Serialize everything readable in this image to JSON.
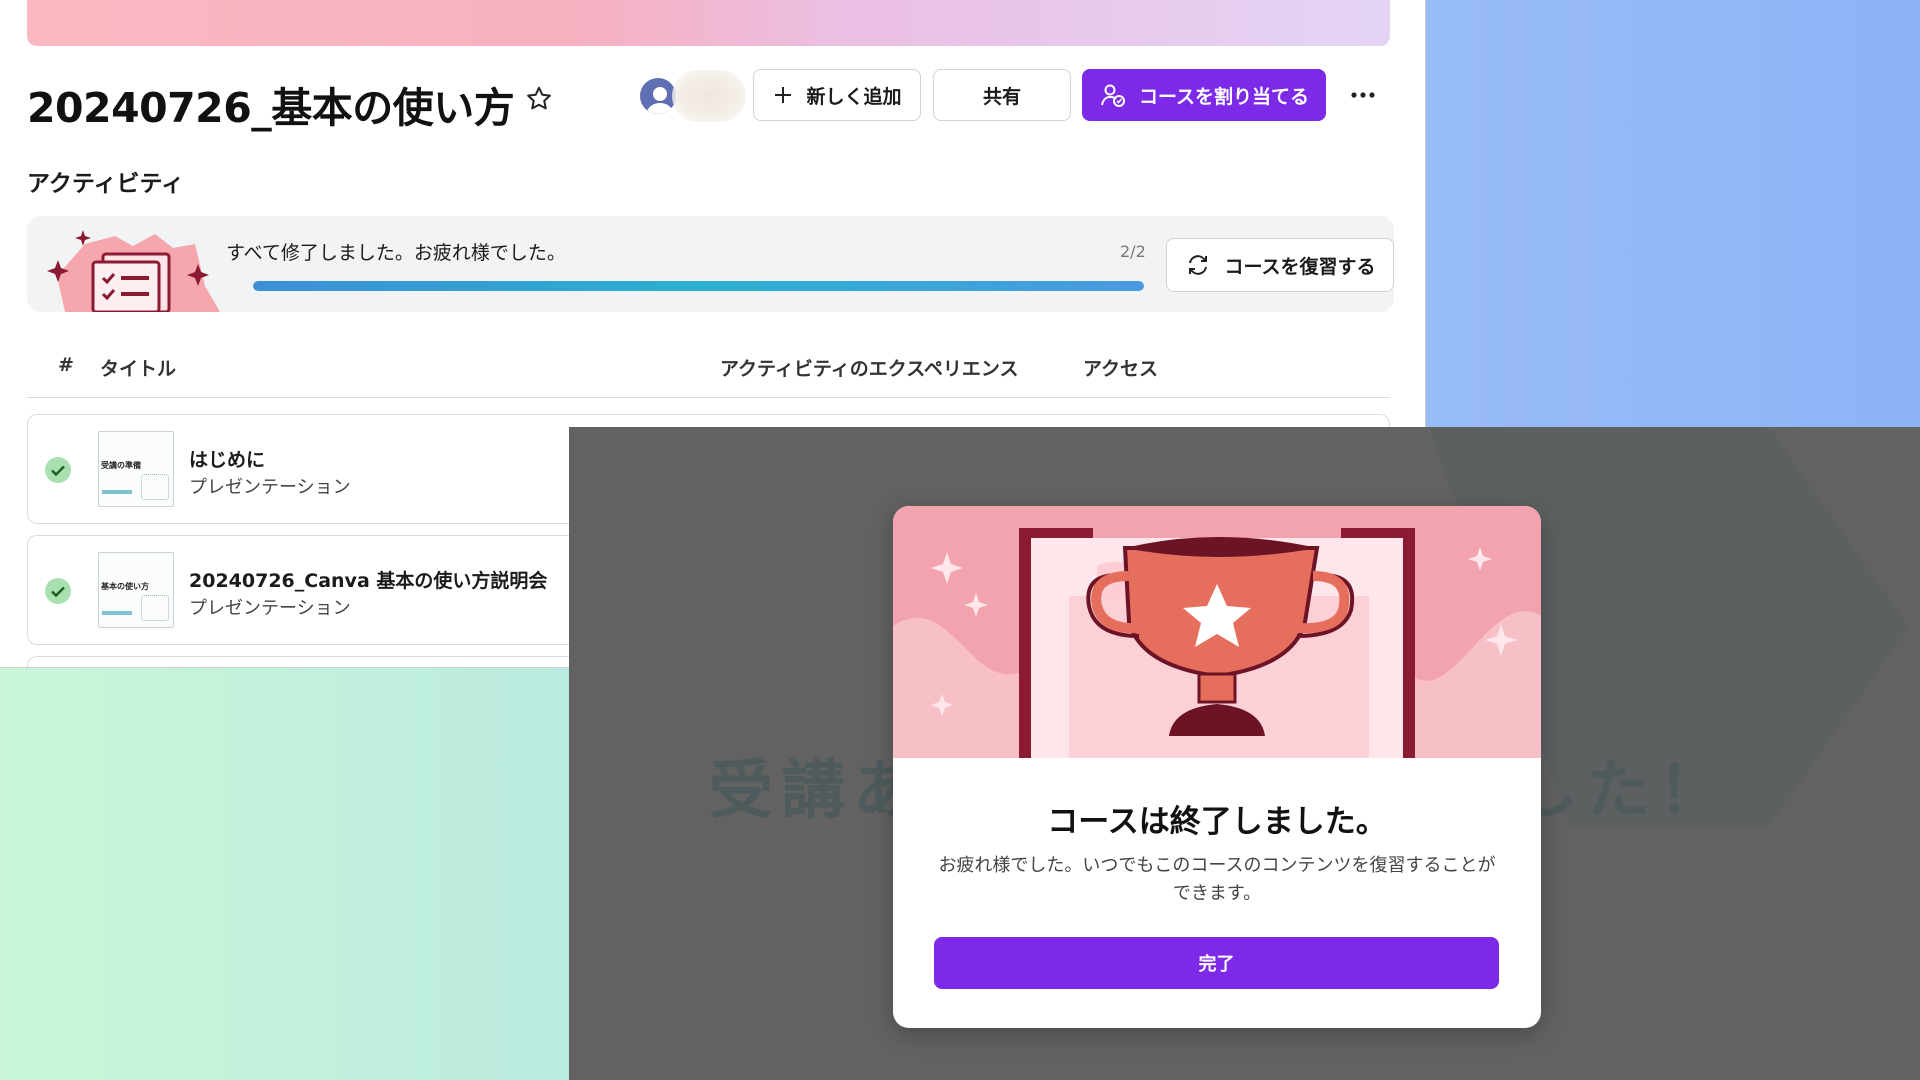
{
  "course": {
    "title": "20240726_基本の使い方"
  },
  "toolbar": {
    "add_label": "新しく追加",
    "share_label": "共有",
    "assign_label": "コースを割り当てる"
  },
  "activity": {
    "heading": "アクティビティ",
    "status_text": "すべて修了しました。お疲れ様でした。",
    "count": "2/2",
    "progress": 1.0,
    "review_label": "コースを復習する"
  },
  "table": {
    "headers": {
      "number": "#",
      "title": "タイトル",
      "experience": "アクティビティのエクスペリエンス",
      "access": "アクセス"
    },
    "rows": [
      {
        "title": "はじめに",
        "type": "プレゼンテーション",
        "thumb_text": "受講の準備",
        "completed": true
      },
      {
        "title": "20240726_Canva 基本の使い方説明会",
        "type": "プレゼンテーション",
        "thumb_text": "基本の使い方",
        "completed": true
      }
    ]
  },
  "background_slide": {
    "text_start": "受講あ",
    "text_end": "した！"
  },
  "modal": {
    "title": "コースは終了しました。",
    "body": "お疲れ様でした。いつでもこのコースのコンテンツを復習することができます。",
    "done_label": "完了"
  },
  "colors": {
    "accent": "#7d2ae8",
    "progress": "#2ea3d4",
    "check": "#4caf50"
  }
}
